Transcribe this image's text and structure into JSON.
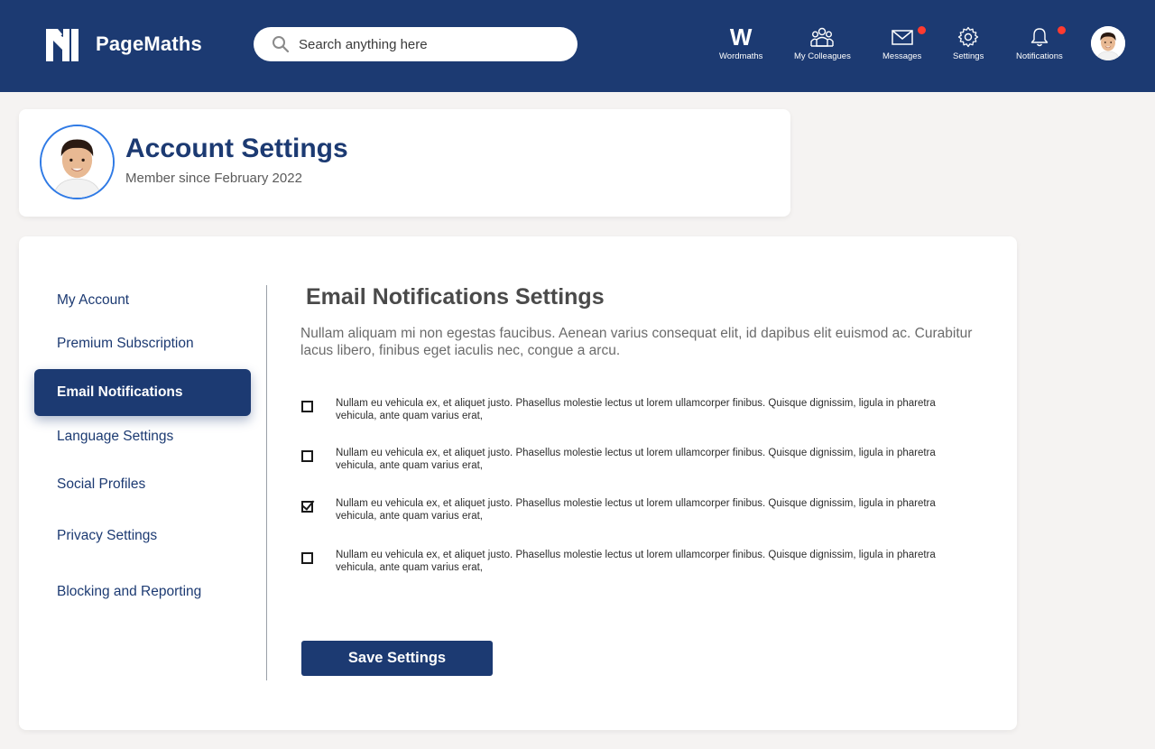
{
  "brand": {
    "name": "PageMaths"
  },
  "search": {
    "placeholder": "Search anything here"
  },
  "nav": {
    "wordmaths": {
      "label": "Wordmaths",
      "glyph": "W"
    },
    "colleagues": {
      "label": "My Colleagues"
    },
    "messages": {
      "label": "Messages",
      "has_badge": true
    },
    "settings": {
      "label": "Settings"
    },
    "notifications": {
      "label": "Notifications",
      "has_badge": true
    }
  },
  "profile": {
    "title": "Account Settings",
    "member_since": "Member since February 2022"
  },
  "sidebar": {
    "items": [
      {
        "label": "My Account"
      },
      {
        "label": "Premium Subscription"
      },
      {
        "label": "Email Notifications",
        "active": true
      },
      {
        "label": "Language Settings"
      },
      {
        "label": "Social Profiles"
      },
      {
        "label": "Privacy Settings"
      },
      {
        "label": "Blocking and Reporting"
      }
    ]
  },
  "content": {
    "title": "Email Notifications Settings",
    "description": "Nullam aliquam mi non egestas faucibus. Aenean varius consequat elit, id dapibus elit euismod ac. Curabitur lacus libero, finibus eget iaculis nec, congue a arcu.",
    "options": [
      {
        "text": "Nullam eu vehicula ex, et aliquet justo. Phasellus molestie lectus ut lorem ullamcorper finibus. Quisque dignissim, ligula in pharetra vehicula, ante quam varius erat,",
        "checked": false
      },
      {
        "text": "Nullam eu vehicula ex, et aliquet justo. Phasellus molestie lectus ut lorem ullamcorper finibus. Quisque dignissim, ligula in pharetra vehicula, ante quam varius erat,",
        "checked": false
      },
      {
        "text": "Nullam eu vehicula ex, et aliquet justo. Phasellus molestie lectus ut lorem ullamcorper finibus. Quisque dignissim, ligula in pharetra vehicula, ante quam varius erat,",
        "checked": true
      },
      {
        "text": "Nullam eu vehicula ex, et aliquet justo. Phasellus molestie lectus ut lorem ullamcorper finibus. Quisque dignissim, ligula in pharetra vehicula, ante quam varius erat,",
        "checked": false
      }
    ],
    "save_label": "Save Settings"
  },
  "colors": {
    "primary": "#1c3a72",
    "badge": "#ff3b30",
    "avatar_ring": "#2f7ae5",
    "background": "#f5f3f2"
  },
  "icons": {
    "search": "search-icon",
    "colleagues": "people-icon",
    "messages": "envelope-icon",
    "settings": "gear-icon",
    "notifications": "bell-icon"
  }
}
